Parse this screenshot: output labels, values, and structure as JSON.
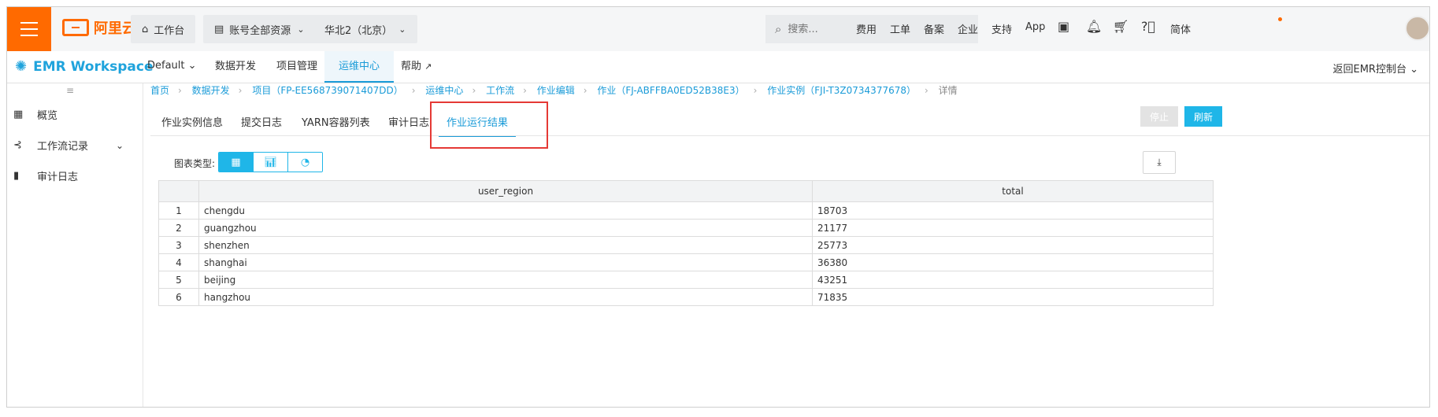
{
  "topbar": {
    "brand": "阿里云",
    "workbench": "工作台",
    "resources": "账号全部资源",
    "region": "华北2（北京）",
    "search_placeholder": "搜索...",
    "nav": [
      "费用",
      "工单",
      "备案",
      "企业",
      "支持",
      "App"
    ],
    "language": "简体"
  },
  "subbar": {
    "product": "EMR Workspace",
    "workspace": "Default",
    "tabs": [
      "数据开发",
      "项目管理",
      "运维中心",
      "帮助"
    ],
    "active_tab": "运维中心",
    "return_link": "返回EMR控制台"
  },
  "sidebar": {
    "items": [
      "概览",
      "工作流记录",
      "审计日志"
    ]
  },
  "breadcrumb": [
    "首页",
    "数据开发",
    "项目（FP-EE568739071407DD）",
    "运维中心",
    "工作流",
    "作业编辑",
    "作业（FJ-ABFFBA0ED52B38E3）",
    "作业实例（FJI-T3Z0734377678）",
    "详情"
  ],
  "page_tabs": [
    "作业实例信息",
    "提交日志",
    "YARN容器列表",
    "审计日志",
    "作业运行结果"
  ],
  "active_page_tab": "作业运行结果",
  "actions": {
    "stop": "停止",
    "refresh": "刷新"
  },
  "chart_type_label": "图表类型:",
  "table": {
    "columns": [
      "user_region",
      "total"
    ],
    "rows": [
      [
        "1",
        "chengdu",
        "18703"
      ],
      [
        "2",
        "guangzhou",
        "21177"
      ],
      [
        "3",
        "shenzhen",
        "25773"
      ],
      [
        "4",
        "shanghai",
        "36380"
      ],
      [
        "5",
        "beijing",
        "43251"
      ],
      [
        "6",
        "hangzhou",
        "71835"
      ]
    ]
  },
  "colors": {
    "brand": "#ff6a00",
    "accent": "#1fb6e8",
    "highlight": "#e53935"
  }
}
